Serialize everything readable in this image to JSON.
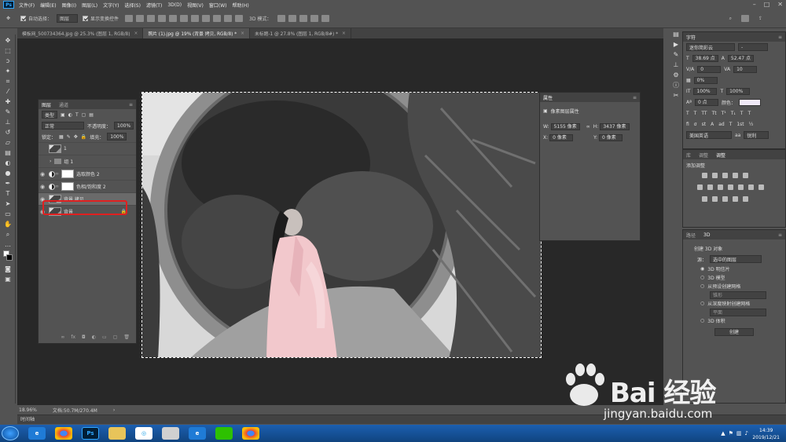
{
  "menubar": {
    "items": [
      "文件(F)",
      "编辑(E)",
      "图像(I)",
      "图层(L)",
      "文字(Y)",
      "选择(S)",
      "滤镜(T)",
      "3D(D)",
      "视图(V)",
      "窗口(W)",
      "帮助(H)"
    ]
  },
  "options": {
    "auto_select_label": "自动选择：",
    "auto_select_value": "图层",
    "show_transform_label": "显示变换控件",
    "mode_3d_label": "3D 模式："
  },
  "tabs": [
    {
      "label": "模板网_500734364.jpg @ 25.3% (图层 1, RGB/8)"
    },
    {
      "label": "照片 (1).jpg @ 19% (背景 拷贝, RGB/8) *"
    },
    {
      "label": "未标题-1 @ 27.8% (图层 1, RGB/8#) *"
    }
  ],
  "status": {
    "zoom": "18.96%",
    "doc": "文档:50.7M/270.4M"
  },
  "timeline_label": "时间轴",
  "layers_panel": {
    "tabs": [
      "图层",
      "通道"
    ],
    "filter_label": "类型",
    "blend_mode": "正常",
    "opacity_label": "不透明度：",
    "opacity_value": "100%",
    "lock_label": "锁定：",
    "fill_label": "填充：",
    "fill_value": "100%",
    "layers": [
      {
        "name": "1"
      },
      {
        "name": "组 1"
      },
      {
        "name": "选取颜色 2"
      },
      {
        "name": "色相/饱和度 2"
      },
      {
        "name": "背景 拷贝"
      },
      {
        "name": "背景"
      }
    ]
  },
  "properties_panel": {
    "title": "属性",
    "subtitle": "像素图层属性",
    "w_label": "W:",
    "w_value": "5155 像素",
    "h_label": "H:",
    "h_value": "3437 像素",
    "x_label": "X:",
    "x_value": "0 像素",
    "y_label": "Y:",
    "y_value": "0 像素"
  },
  "character_panel": {
    "title": "字符",
    "font": "迷你简彩云",
    "font_style": "-",
    "size": "38.69 点",
    "leading": "52.47 点",
    "kerning": "0",
    "tracking": "10",
    "scale_pct": "0%",
    "vscale": "100%",
    "hscale": "100%",
    "baseline": "0 点",
    "color_label": "颜色：",
    "language": "美国英语",
    "aa": "锐利"
  },
  "adjust_panel": {
    "tabs": [
      "库",
      "调整",
      "调整"
    ],
    "add_label": "添加调整"
  },
  "threed_panel": {
    "tabs": [
      "路径",
      "3D"
    ],
    "create_label": "创建 3D 对象",
    "source_label": "源：",
    "source_value": "选中的图层",
    "options": [
      "3D 明信片",
      "3D 模型",
      "从预设创建网格",
      "从深度映射创建网格",
      "3D 体积"
    ],
    "preset_value": "锥形",
    "depth_value": "平面",
    "create_button": "创建"
  },
  "taskbar": {
    "clock_time": "14:39",
    "clock_date": "2019/12/21"
  },
  "watermark": {
    "brand": "Bai 经验",
    "url": "jingyan.baidu.com"
  }
}
